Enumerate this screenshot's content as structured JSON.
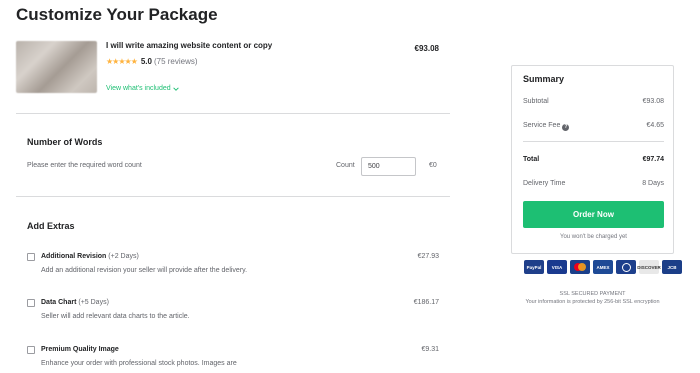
{
  "page": {
    "title": "Customize Your Package"
  },
  "gig": {
    "title": "I will write amazing website content or copy",
    "price": "€93.08",
    "rating_value": "5.0",
    "rating_count": "(75 reviews)",
    "stars": "★★★★★",
    "view_included": "View what's included"
  },
  "words": {
    "title": "Number of Words",
    "description": "Please enter the required word count",
    "count_label": "Count",
    "count_value": "500",
    "price": "€0"
  },
  "extras": {
    "title": "Add Extras",
    "items": [
      {
        "name": "Additional Revision",
        "days": "(+2 Days)",
        "description": "Add an additional revision your seller will provide after the delivery.",
        "price": "€27.93"
      },
      {
        "name": "Data Chart",
        "days": "(+5 Days)",
        "description": "Seller will add relevant data charts to the article.",
        "price": "€186.17"
      },
      {
        "name": "Premium Quality Image",
        "days": "",
        "description": "Enhance your order with professional stock photos. Images are",
        "price": "€9.31"
      }
    ]
  },
  "summary": {
    "title": "Summary",
    "subtotal_label": "Subtotal",
    "subtotal_value": "€93.08",
    "service_fee_label": "Service Fee",
    "service_fee_value": "€4.65",
    "total_label": "Total",
    "total_value": "€97.74",
    "delivery_label": "Delivery Time",
    "delivery_value": "8 Days",
    "order_button": "Order Now",
    "not_charged": "You won't be charged yet"
  },
  "payments": {
    "paypal": "PayPal",
    "visa": "VISA",
    "amex": "AMEX",
    "discover": "DISCOVER",
    "jcb": "JCB"
  },
  "ssl": {
    "line1": "SSL SECURED PAYMENT",
    "line2": "Your information is protected by 256-bit SSL encryption"
  },
  "colors": {
    "accent": "#1dbf73",
    "star": "#ffb33e"
  }
}
